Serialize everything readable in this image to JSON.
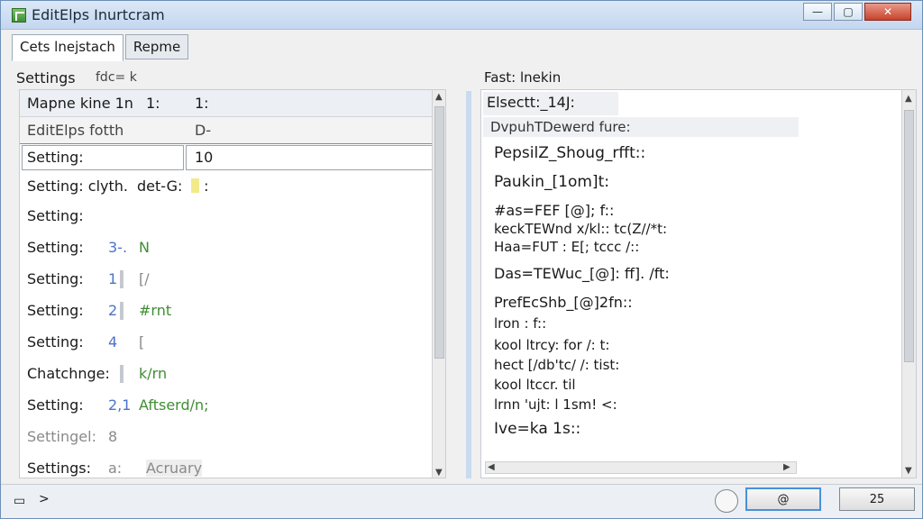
{
  "window": {
    "title": "EditElps Inurtcram",
    "minimize_glyph": "—",
    "maximize_glyph": "▢",
    "close_glyph": "✕",
    "app_icon": "grid-edit-icon"
  },
  "tabs": [
    {
      "label": "Cets lnejstach",
      "active": true
    },
    {
      "label": "Repme",
      "active": false
    }
  ],
  "left": {
    "heading": "Settings",
    "subheading": "fdc= k",
    "header_row": {
      "c1": "Mapne kine 1n",
      "c2": "1:",
      "c3": "1:"
    },
    "sub_row": {
      "c1": "EditElps fotth",
      "c3": "D-"
    },
    "edit_row": {
      "label": "Setting:",
      "value": "10"
    },
    "rows": [
      {
        "label": "Setting: clyth.",
        "value": "det-G:"
      },
      {
        "label": "Setting:",
        "value": ""
      },
      {
        "label": "Setting:",
        "value": "3-.",
        "extra": "N"
      },
      {
        "label": "Setting:",
        "value": "1",
        "extra": "[/"
      },
      {
        "label": "Setting:",
        "value": "2",
        "extra": "#rnt"
      },
      {
        "label": "Setting:",
        "value": "4",
        "extra": "["
      },
      {
        "label": "Chatchnge:",
        "value": "",
        "extra": "k/rn"
      },
      {
        "label": "Setting:",
        "value": "2,1",
        "extra": "Aftserd/n;"
      },
      {
        "label": "Settingel:",
        "value": "8",
        "extra": ""
      },
      {
        "label": "Settings:",
        "value": "a:",
        "extra": "Acruary"
      }
    ]
  },
  "right": {
    "heading": "Fast: lnekin",
    "top_row": "Elsectt:_14J:",
    "sub_row": "DvpuhTDewerd fure:",
    "lines": [
      "PepsilZ_Shoug_rfft::",
      "Paukin_[1om]t:",
      "#as=FEF [@]; f::",
      "keckTEWnd x/kl:: tc(Z//*t:",
      "Haa=FUT : E[; tccc /::",
      "Das=TEWuc_[@]: ff]. /ft:",
      "PrefEcShb_[@]2fn::",
      "lron : f::",
      "kool ltrcy: for /: t:",
      "hect [/db'tc/ /: tist:",
      "kool ltccr. til",
      "lrnn 'ujt: l 1sm! <:",
      "Ive=ka  1s::"
    ]
  },
  "status": {
    "left_icon": "document-icon",
    "chevron": ">",
    "ok_glyph": "@",
    "page_label": "25"
  }
}
